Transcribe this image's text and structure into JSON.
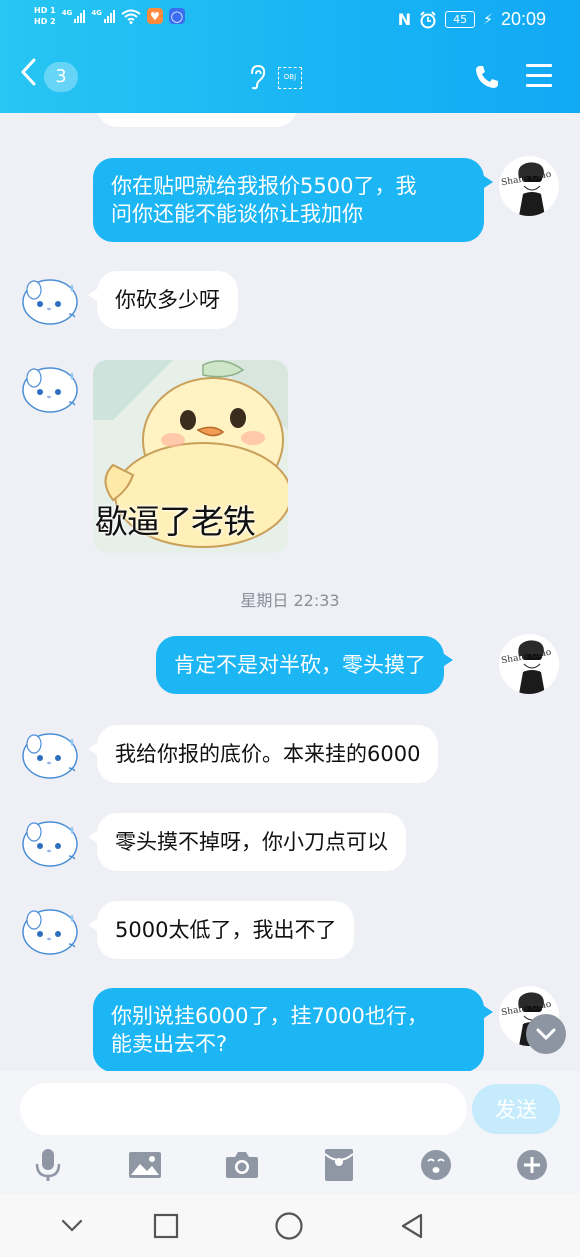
{
  "status_bar": {
    "network_labels": [
      "HD 1",
      "HD 2"
    ],
    "signal_label_1": "4G",
    "signal_label_2": "4G",
    "battery": "45",
    "time": "20:09"
  },
  "nav": {
    "back_icon": "chevron-left-icon",
    "unread_count": "3",
    "obj_label": "OBJ",
    "icons": [
      "ear-icon",
      "obj-icon",
      "phone-icon",
      "menu-icon"
    ]
  },
  "messages": [
    {
      "side": "out",
      "text_lines": [
        "你在贴吧就给我报价5500了，我",
        "问你还能不能谈你让我加你"
      ]
    },
    {
      "side": "in",
      "text": "你砍多少呀"
    },
    {
      "side": "in",
      "type": "sticker",
      "caption": "歇逼了老铁"
    },
    {
      "type": "timestamp",
      "text": "星期日 22:33"
    },
    {
      "side": "out",
      "text": "肯定不是对半砍，零头摸了"
    },
    {
      "side": "in",
      "text": "我给你报的底价。本来挂的6000"
    },
    {
      "side": "in",
      "text": "零头摸不掉呀，你小刀点可以"
    },
    {
      "side": "in",
      "text": "5000太低了，我出不了"
    },
    {
      "side": "out",
      "text_lines": [
        "你别说挂6000了，挂7000也行，",
        "能卖出去不?"
      ]
    }
  ],
  "self_avatar_text": "Share Cmo",
  "input": {
    "value": "",
    "send_label": "发送"
  },
  "toolbar_icons": [
    "microphone-icon",
    "image-icon",
    "camera-icon",
    "red-packet-icon",
    "emoji-icon",
    "plus-icon"
  ],
  "system_nav_icons": [
    "collapse-icon",
    "recents-icon",
    "home-icon",
    "back-triangle-icon"
  ],
  "colors": {
    "header": "#18b3f4",
    "bubble_out": "#1db6f5",
    "bubble_in": "#ffffff",
    "background": "#eef0f6",
    "send_disabled": "#c5ebfc"
  }
}
